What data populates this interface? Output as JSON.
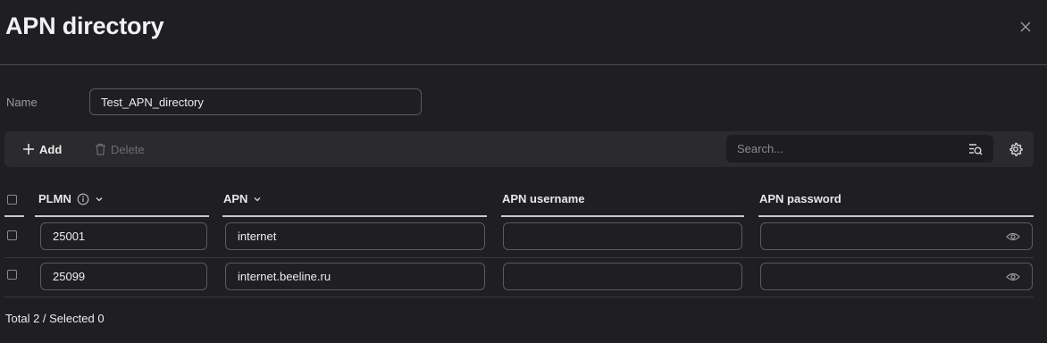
{
  "dialog": {
    "title": "APN directory"
  },
  "form": {
    "name_label": "Name",
    "name_value": "Test_APN_directory"
  },
  "toolbar": {
    "add_label": "Add",
    "delete_label": "Delete",
    "search_placeholder": "Search..."
  },
  "table": {
    "columns": [
      "PLMN",
      "APN",
      "APN username",
      "APN password"
    ],
    "rows": [
      {
        "plmn": "25001",
        "apn": "internet",
        "username": "",
        "password": ""
      },
      {
        "plmn": "25099",
        "apn": "internet.beeline.ru",
        "username": "",
        "password": ""
      }
    ]
  },
  "footer": {
    "summary": "Total 2 / Selected 0"
  },
  "colors": {
    "background": "#1f1f21",
    "toolbar": "#2b2b2e",
    "border": "#5b5b60"
  }
}
